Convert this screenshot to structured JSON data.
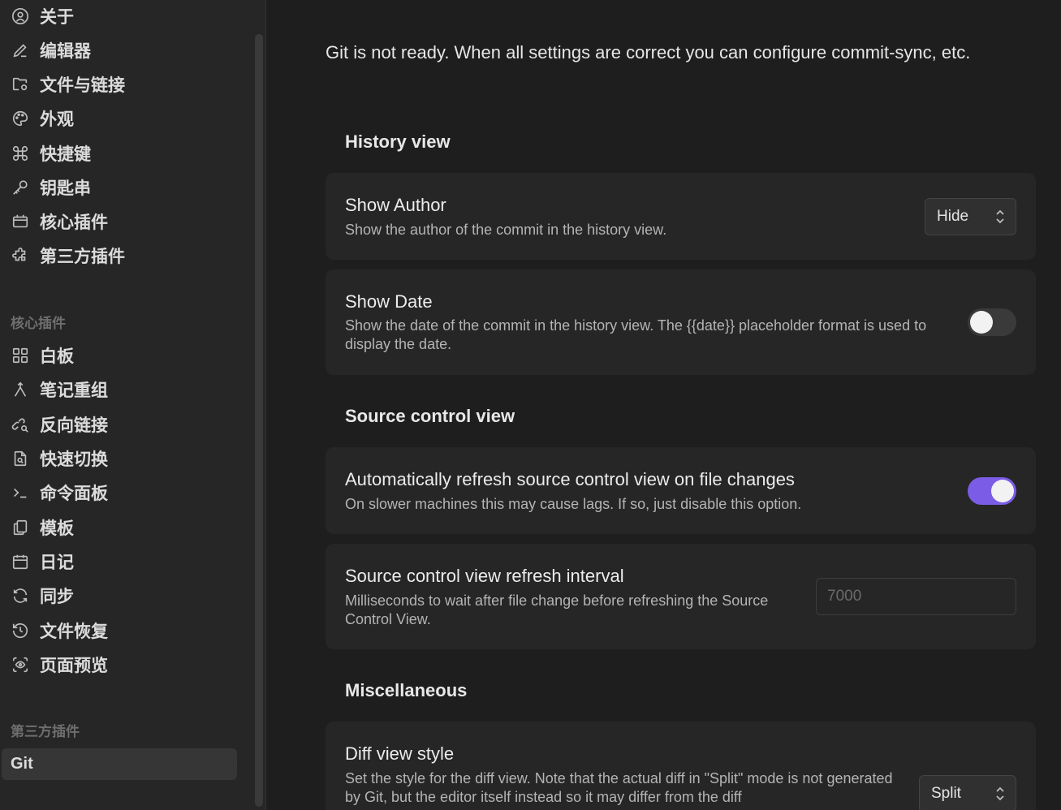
{
  "sidebar": {
    "options_items": [
      {
        "label": "关于",
        "icon": "user-circle-icon"
      },
      {
        "label": "编辑器",
        "icon": "pencil-icon"
      },
      {
        "label": "文件与链接",
        "icon": "folder-cog-icon"
      },
      {
        "label": "外观",
        "icon": "palette-icon"
      },
      {
        "label": "快捷键",
        "icon": "command-icon"
      },
      {
        "label": "钥匙串",
        "icon": "key-icon"
      },
      {
        "label": "核心插件",
        "icon": "calendar-box-icon"
      },
      {
        "label": "第三方插件",
        "icon": "puzzle-icon"
      }
    ],
    "core_section_label": "核心插件",
    "core_items": [
      {
        "label": "白板",
        "icon": "layout-grid-icon"
      },
      {
        "label": "笔记重组",
        "icon": "merge-icon"
      },
      {
        "label": "反向链接",
        "icon": "link-search-icon"
      },
      {
        "label": "快速切换",
        "icon": "file-search-icon"
      },
      {
        "label": "命令面板",
        "icon": "terminal-icon"
      },
      {
        "label": "模板",
        "icon": "copy-icon"
      },
      {
        "label": "日记",
        "icon": "calendar-icon"
      },
      {
        "label": "同步",
        "icon": "refresh-icon"
      },
      {
        "label": "文件恢复",
        "icon": "history-icon"
      },
      {
        "label": "页面预览",
        "icon": "scan-eye-icon"
      }
    ],
    "community_section_label": "第三方插件",
    "community_items": [
      {
        "label": "Git"
      }
    ]
  },
  "main": {
    "notice": "Git is not ready. When all settings are correct you can configure commit-sync, etc.",
    "history_heading": "History view",
    "show_author": {
      "name": "Show Author",
      "desc": "Show the author of the commit in the history view.",
      "value": "Hide"
    },
    "show_date": {
      "name": "Show Date",
      "desc": "Show the date of the commit in the history view. The {{date}} placeholder format is used to display the date.",
      "enabled": false
    },
    "source_heading": "Source control view",
    "auto_refresh": {
      "name": "Automatically refresh source control view on file changes",
      "desc": "On slower machines this may cause lags. If so, just disable this option.",
      "enabled": true
    },
    "refresh_interval": {
      "name": "Source control view refresh interval",
      "desc": "Milliseconds to wait after file change before refreshing the Source Control View.",
      "placeholder": "7000"
    },
    "misc_heading": "Miscellaneous",
    "diff_style": {
      "name": "Diff view style",
      "desc": "Set the style for the diff view. Note that the actual diff in \"Split\" mode is not generated by Git, but the editor itself instead so it may differ from the diff",
      "value": "Split"
    }
  },
  "colors": {
    "accent": "#7b5ce6",
    "background": "#1e1e1e",
    "sidebar": "#262626"
  }
}
